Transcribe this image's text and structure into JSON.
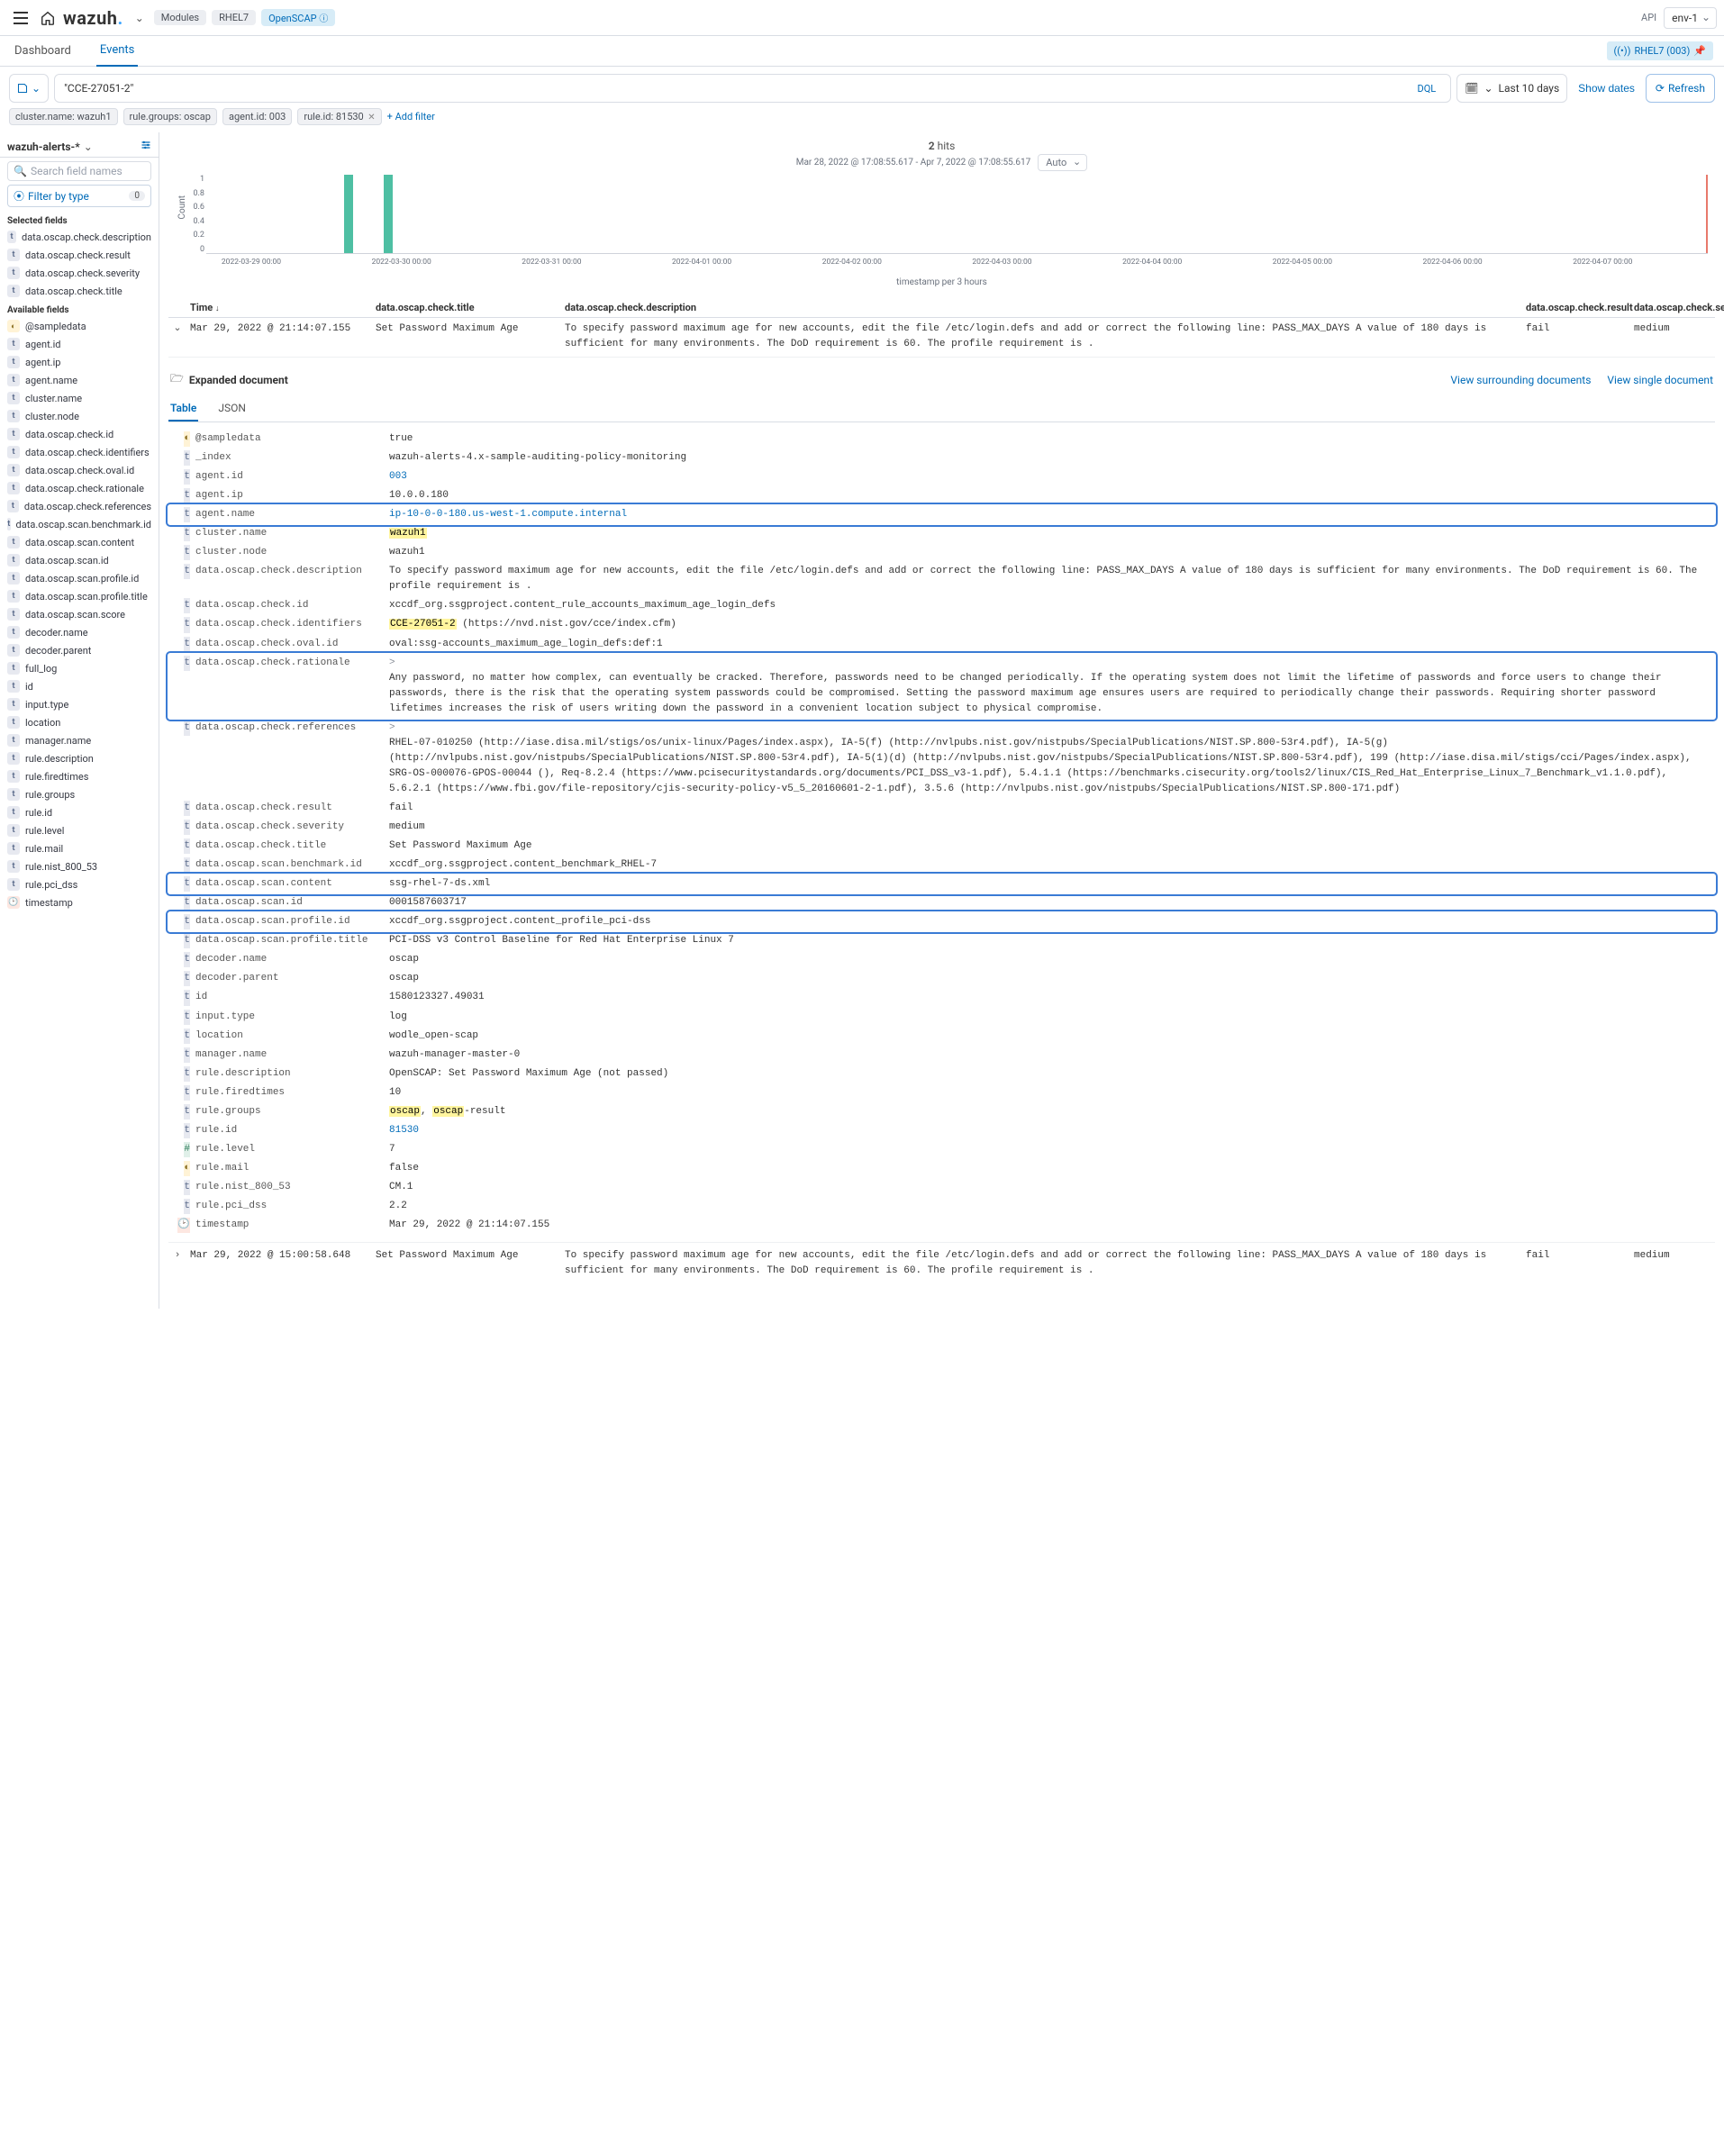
{
  "brand": "wazuh",
  "top": {
    "crumbs": [
      "Modules",
      "RHEL7",
      "OpenSCAP"
    ],
    "api": "API",
    "env": "env-1",
    "agent_badge": "RHEL7 (003)"
  },
  "tabs": {
    "dashboard": "Dashboard",
    "events": "Events"
  },
  "query": {
    "text": "\"CCE-27051-2\"",
    "dql": "DQL",
    "date": "Last 10 days",
    "show": "Show dates",
    "refresh": "Refresh"
  },
  "filters": [
    "cluster.name: wazuh1",
    "rule.groups: oscap",
    "agent.id: 003",
    "rule.id: 81530"
  ],
  "addfilter": "+ Add filter",
  "sidebar": {
    "index": "wazuh-alerts-*",
    "search_ph": "Search field names",
    "filter_type": "Filter by type",
    "filter_count": "0",
    "hdr_sel": "Selected fields",
    "hdr_avail": "Available fields",
    "selected": [
      {
        "t": "t",
        "n": "data.oscap.check.description"
      },
      {
        "t": "t",
        "n": "data.oscap.check.result"
      },
      {
        "t": "t",
        "n": "data.oscap.check.severity"
      },
      {
        "t": "t",
        "n": "data.oscap.check.title"
      }
    ],
    "available": [
      {
        "t": "g",
        "n": "@sampledata"
      },
      {
        "t": "t",
        "n": "agent.id"
      },
      {
        "t": "t",
        "n": "agent.ip"
      },
      {
        "t": "t",
        "n": "agent.name"
      },
      {
        "t": "t",
        "n": "cluster.name"
      },
      {
        "t": "t",
        "n": "cluster.node"
      },
      {
        "t": "t",
        "n": "data.oscap.check.id"
      },
      {
        "t": "t",
        "n": "data.oscap.check.identifiers"
      },
      {
        "t": "t",
        "n": "data.oscap.check.oval.id"
      },
      {
        "t": "t",
        "n": "data.oscap.check.rationale"
      },
      {
        "t": "t",
        "n": "data.oscap.check.references"
      },
      {
        "t": "t",
        "n": "data.oscap.scan.benchmark.id"
      },
      {
        "t": "t",
        "n": "data.oscap.scan.content"
      },
      {
        "t": "t",
        "n": "data.oscap.scan.id"
      },
      {
        "t": "t",
        "n": "data.oscap.scan.profile.id"
      },
      {
        "t": "t",
        "n": "data.oscap.scan.profile.title"
      },
      {
        "t": "t",
        "n": "data.oscap.scan.score"
      },
      {
        "t": "t",
        "n": "decoder.name"
      },
      {
        "t": "t",
        "n": "decoder.parent"
      },
      {
        "t": "t",
        "n": "full_log"
      },
      {
        "t": "t",
        "n": "id"
      },
      {
        "t": "t",
        "n": "input.type"
      },
      {
        "t": "t",
        "n": "location"
      },
      {
        "t": "t",
        "n": "manager.name"
      },
      {
        "t": "t",
        "n": "rule.description"
      },
      {
        "t": "t",
        "n": "rule.firedtimes"
      },
      {
        "t": "t",
        "n": "rule.groups"
      },
      {
        "t": "t",
        "n": "rule.id"
      },
      {
        "t": "t",
        "n": "rule.level"
      },
      {
        "t": "t",
        "n": "rule.mail"
      },
      {
        "t": "t",
        "n": "rule.nist_800_53"
      },
      {
        "t": "t",
        "n": "rule.pci_dss"
      },
      {
        "t": "c",
        "n": "timestamp"
      }
    ]
  },
  "hits": {
    "n": "2",
    "label": "hits"
  },
  "range": "Mar 28, 2022 @ 17:08:55.617 - Apr 7, 2022 @ 17:08:55.617",
  "auto": "Auto",
  "chart_data": {
    "type": "bar",
    "ylabel": "Count",
    "xlabel": "timestamp per 3 hours",
    "yticks": [
      "1",
      "0.8",
      "0.6",
      "0.4",
      "0.2",
      "0"
    ],
    "xticks": [
      "2022-03-29 00:00",
      "2022-03-30 00:00",
      "2022-03-31 00:00",
      "2022-04-01 00:00",
      "2022-04-02 00:00",
      "2022-04-03 00:00",
      "2022-04-04 00:00",
      "2022-04-05 00:00",
      "2022-04-06 00:00",
      "2022-04-07 00:00"
    ],
    "xlim": [
      "2022-03-28 17:08:55",
      "2022-04-07 17:08:55"
    ],
    "ylim": [
      0,
      1
    ],
    "values": [
      {
        "x": "2022-03-29 15:00",
        "y": 1
      },
      {
        "x": "2022-03-29 21:00",
        "y": 1
      }
    ]
  },
  "eheaders": {
    "time": "Time",
    "title": "data.oscap.check.title",
    "desc": "data.oscap.check.description",
    "res": "data.oscap.check.result",
    "sev": "data.oscap.check.severity"
  },
  "rows": [
    {
      "time": "Mar 29, 2022 @ 21:14:07.155",
      "title": "Set Password Maximum Age",
      "desc": "To specify password maximum age for new accounts, edit the file /etc/login.defs and add or correct the following line: PASS_MAX_DAYS A value of 180 days is sufficient for many environments. The DoD requirement is 60. The profile requirement is .",
      "res": "fail",
      "sev": "medium"
    },
    {
      "time": "Mar 29, 2022 @ 15:00:58.648",
      "title": "Set Password Maximum Age",
      "desc": "To specify password maximum age for new accounts, edit the file /etc/login.defs and add or correct the following line: PASS_MAX_DAYS A value of 180 days is sufficient for many environments. The DoD requirement is 60. The profile requirement is .",
      "res": "fail",
      "sev": "medium"
    }
  ],
  "exp": {
    "label": "Expanded document",
    "surrounding": "View surrounding documents",
    "single": "View single document",
    "tab_table": "Table",
    "tab_json": "JSON"
  },
  "doc": [
    {
      "t": "g",
      "k": "@sampledata",
      "v": "true"
    },
    {
      "t": "t",
      "k": "_index",
      "v": "wazuh-alerts-4.x-sample-auditing-policy-monitoring"
    },
    {
      "t": "t",
      "k": "agent.id",
      "v": "003",
      "link": true
    },
    {
      "t": "t",
      "k": "agent.ip",
      "v": "10.0.0.180"
    },
    {
      "t": "t",
      "k": "agent.name",
      "v": "ip-10-0-0-180.us-west-1.compute.internal",
      "link": true,
      "box": true
    },
    {
      "t": "t",
      "k": "cluster.name",
      "v": "wazuh1",
      "hl": true
    },
    {
      "t": "t",
      "k": "cluster.node",
      "v": "wazuh1"
    },
    {
      "t": "t",
      "k": "data.oscap.check.description",
      "v": "To specify password maximum age for new accounts, edit the file /etc/login.defs and add or correct the following line: PASS_MAX_DAYS A value of 180 days is sufficient for many environments. The DoD requirement is 60. The profile requirement is ."
    },
    {
      "t": "t",
      "k": "data.oscap.check.id",
      "v": "xccdf_org.ssgproject.content_rule_accounts_maximum_age_login_defs"
    },
    {
      "t": "t",
      "k": "data.oscap.check.identifiers",
      "v": "CCE-27051-2 (https://nvd.nist.gov/cce/index.cfm)",
      "hlprefix": "CCE-27051-2"
    },
    {
      "t": "t",
      "k": "data.oscap.check.oval.id",
      "v": "oval:ssg-accounts_maximum_age_login_defs:def:1"
    },
    {
      "t": "t",
      "k": "data.oscap.check.rationale",
      "v": "Any password, no matter how complex, can eventually be cracked. Therefore, passwords need to be changed periodically. If the operating system does not limit the lifetime of passwords and force users to change their passwords, there is the risk that the operating system passwords could be compromised. Setting the password maximum age ensures users are required to periodically change their passwords. Requiring shorter password lifetimes increases the risk of users writing down the password in a convenient location subject to physical compromise.",
      "box": true,
      "pre": ">"
    },
    {
      "t": "t",
      "k": "data.oscap.check.references",
      "v": "RHEL-07-010250 (http://iase.disa.mil/stigs/os/unix-linux/Pages/index.aspx), IA-5(f) (http://nvlpubs.nist.gov/nistpubs/SpecialPublications/NIST.SP.800-53r4.pdf), IA-5(g) (http://nvlpubs.nist.gov/nistpubs/SpecialPublications/NIST.SP.800-53r4.pdf), IA-5(1)(d) (http://nvlpubs.nist.gov/nistpubs/SpecialPublications/NIST.SP.800-53r4.pdf), 199 (http://iase.disa.mil/stigs/cci/Pages/index.aspx), SRG-OS-000076-GPOS-00044 (), Req-8.2.4 (https://www.pcisecuritystandards.org/documents/PCI_DSS_v3-1.pdf), 5.4.1.1 (https://benchmarks.cisecurity.org/tools2/linux/CIS_Red_Hat_Enterprise_Linux_7_Benchmark_v1.1.0.pdf), 5.6.2.1 (https://www.fbi.gov/file-repository/cjis-security-policy-v5_5_20160601-2-1.pdf), 3.5.6 (http://nvlpubs.nist.gov/nistpubs/SpecialPublications/NIST.SP.800-171.pdf)",
      "pre": ">"
    },
    {
      "t": "t",
      "k": "data.oscap.check.result",
      "v": "fail"
    },
    {
      "t": "t",
      "k": "data.oscap.check.severity",
      "v": "medium"
    },
    {
      "t": "t",
      "k": "data.oscap.check.title",
      "v": "Set Password Maximum Age"
    },
    {
      "t": "t",
      "k": "data.oscap.scan.benchmark.id",
      "v": "xccdf_org.ssgproject.content_benchmark_RHEL-7"
    },
    {
      "t": "t",
      "k": "data.oscap.scan.content",
      "v": "ssg-rhel-7-ds.xml",
      "box": true
    },
    {
      "t": "t",
      "k": "data.oscap.scan.id",
      "v": "0001587603717"
    },
    {
      "t": "t",
      "k": "data.oscap.scan.profile.id",
      "v": "xccdf_org.ssgproject.content_profile_pci-dss",
      "box": true
    },
    {
      "t": "t",
      "k": "data.oscap.scan.profile.title",
      "v": "PCI-DSS v3 Control Baseline for Red Hat Enterprise Linux 7"
    },
    {
      "t": "t",
      "k": "decoder.name",
      "v": "oscap"
    },
    {
      "t": "t",
      "k": "decoder.parent",
      "v": "oscap"
    },
    {
      "t": "t",
      "k": "id",
      "v": "1580123327.49031"
    },
    {
      "t": "t",
      "k": "input.type",
      "v": "log"
    },
    {
      "t": "t",
      "k": "location",
      "v": "wodle_open-scap"
    },
    {
      "t": "t",
      "k": "manager.name",
      "v": "wazuh-manager-master-0"
    },
    {
      "t": "t",
      "k": "rule.description",
      "v": "OpenSCAP: Set Password Maximum Age (not passed)"
    },
    {
      "t": "t",
      "k": "rule.firedtimes",
      "v": "10"
    },
    {
      "t": "t",
      "k": "rule.groups",
      "v": "oscap, oscap-result",
      "hlwords": [
        "oscap",
        "oscap"
      ]
    },
    {
      "t": "t",
      "k": "rule.id",
      "v": "81530",
      "link": true
    },
    {
      "t": "n",
      "k": "rule.level",
      "v": "7"
    },
    {
      "t": "g",
      "k": "rule.mail",
      "v": "false"
    },
    {
      "t": "t",
      "k": "rule.nist_800_53",
      "v": "CM.1"
    },
    {
      "t": "t",
      "k": "rule.pci_dss",
      "v": "2.2"
    },
    {
      "t": "c",
      "k": "timestamp",
      "v": "Mar 29, 2022 @ 21:14:07.155"
    }
  ]
}
